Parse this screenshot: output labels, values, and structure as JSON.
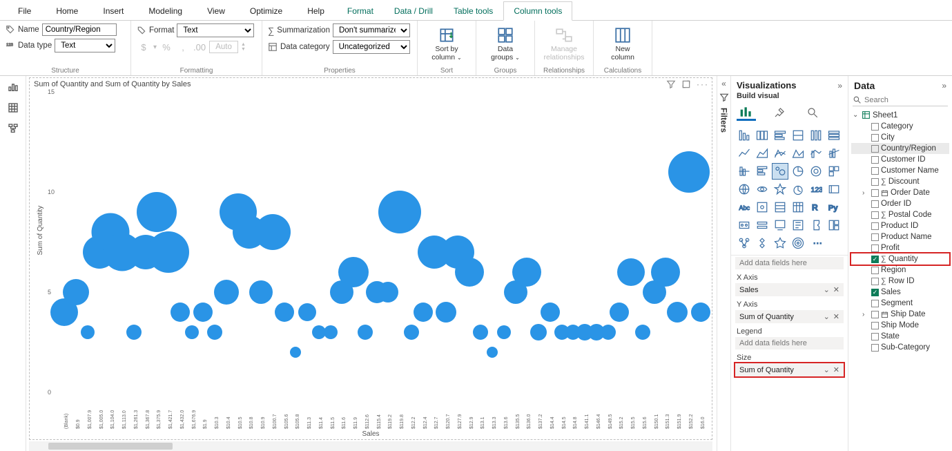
{
  "menu": {
    "file": "File",
    "home": "Home",
    "insert": "Insert",
    "modeling": "Modeling",
    "view": "View",
    "optimize": "Optimize",
    "help": "Help",
    "format": "Format",
    "datadrill": "Data / Drill",
    "tabletools": "Table tools",
    "columntools": "Column tools"
  },
  "ribbon": {
    "structure": {
      "name_lbl": "Name",
      "name_val": "Country/Region",
      "dtype_lbl": "Data type",
      "dtype_val": "Text",
      "group": "Structure"
    },
    "formatting": {
      "fmt_lbl": "Format",
      "fmt_val": "Text",
      "dollar": "$",
      "pct": "%",
      "comma": ",",
      "dec": ".00",
      "auto": "Auto",
      "group": "Formatting"
    },
    "properties": {
      "sum_lbl": "Summarization",
      "sum_val": "Don't summarize",
      "cat_lbl": "Data category",
      "cat_val": "Uncategorized",
      "group": "Properties"
    },
    "sort": {
      "btn1": "Sort by",
      "btn1b": "column",
      "group": "Sort"
    },
    "groups": {
      "btn1": "Data",
      "btn1b": "groups",
      "group": "Groups"
    },
    "rel": {
      "btn1": "Manage",
      "btn1b": "relationships",
      "group": "Relationships"
    },
    "calc": {
      "btn1": "New",
      "btn1b": "column",
      "group": "Calculations"
    }
  },
  "chart": {
    "title": "Sum of Quantity and Sum of Quantity by Sales",
    "ylabel": "Sum of Quantity",
    "xlabel": "Sales",
    "yticks": [
      0,
      5,
      10,
      15
    ],
    "xticks": [
      "(Blank)",
      "$0.9",
      "$1,007.9",
      "$1,005.0",
      "$1,104.0",
      "$1,113.0",
      "$1,261.3",
      "$1,367.8",
      "$1,375.9",
      "$1,421.7",
      "$1,432.0",
      "$1,676.9",
      "$1.9",
      "$10.3",
      "$10.4",
      "$10.5",
      "$10.8",
      "$10.9",
      "$100.7",
      "$105.6",
      "$105.8",
      "$11.3",
      "$11.4",
      "$11.5",
      "$11.6",
      "$11.9",
      "$112.6",
      "$115.4",
      "$119.2",
      "$119.8",
      "$12.2",
      "$12.4",
      "$12.7",
      "$120.7",
      "$127.9",
      "$12.9",
      "$13.1",
      "$13.3",
      "$13.6",
      "$135.5",
      "$136.0",
      "$137.2",
      "$14.4",
      "$14.5",
      "$14.8",
      "$141.1",
      "$146.4",
      "$149.5",
      "$15.2",
      "$15.5",
      "$15.6",
      "$150.1",
      "$151.3",
      "$151.9",
      "$152.2",
      "$16.0"
    ]
  },
  "chart_data": {
    "type": "scatter",
    "xlabel": "Sales",
    "ylabel": "Sum of Quantity",
    "size_field": "Sum of Quantity",
    "ylim": [
      0,
      15
    ],
    "series": [
      {
        "name": "Sum of Quantity",
        "points": [
          {
            "xi": 0,
            "y": 4,
            "s": 40
          },
          {
            "xi": 1,
            "y": 5,
            "s": 38
          },
          {
            "xi": 2,
            "y": 3,
            "s": 20
          },
          {
            "xi": 3,
            "y": 7,
            "s": 48
          },
          {
            "xi": 4,
            "y": 8,
            "s": 55
          },
          {
            "xi": 5,
            "y": 7,
            "s": 55
          },
          {
            "xi": 6,
            "y": 3,
            "s": 22
          },
          {
            "xi": 7,
            "y": 7,
            "s": 50
          },
          {
            "xi": 8,
            "y": 9,
            "s": 58
          },
          {
            "xi": 9,
            "y": 7,
            "s": 60
          },
          {
            "xi": 10,
            "y": 4,
            "s": 28
          },
          {
            "xi": 11,
            "y": 3,
            "s": 20
          },
          {
            "xi": 12,
            "y": 4,
            "s": 28
          },
          {
            "xi": 13,
            "y": 3,
            "s": 22
          },
          {
            "xi": 14,
            "y": 5,
            "s": 36
          },
          {
            "xi": 15,
            "y": 9,
            "s": 54
          },
          {
            "xi": 16,
            "y": 8,
            "s": 48
          },
          {
            "xi": 17,
            "y": 5,
            "s": 34
          },
          {
            "xi": 18,
            "y": 8,
            "s": 52
          },
          {
            "xi": 19,
            "y": 4,
            "s": 28
          },
          {
            "xi": 20,
            "y": 2,
            "s": 16
          },
          {
            "xi": 21,
            "y": 4,
            "s": 26
          },
          {
            "xi": 22,
            "y": 3,
            "s": 20
          },
          {
            "xi": 23,
            "y": 3,
            "s": 20
          },
          {
            "xi": 24,
            "y": 5,
            "s": 34
          },
          {
            "xi": 25,
            "y": 6,
            "s": 44
          },
          {
            "xi": 26,
            "y": 3,
            "s": 22
          },
          {
            "xi": 27,
            "y": 5,
            "s": 32
          },
          {
            "xi": 28,
            "y": 5,
            "s": 30
          },
          {
            "xi": 29,
            "y": 9,
            "s": 62
          },
          {
            "xi": 30,
            "y": 3,
            "s": 22
          },
          {
            "xi": 31,
            "y": 4,
            "s": 28
          },
          {
            "xi": 32,
            "y": 7,
            "s": 48
          },
          {
            "xi": 33,
            "y": 4,
            "s": 30
          },
          {
            "xi": 34,
            "y": 7,
            "s": 48
          },
          {
            "xi": 35,
            "y": 6,
            "s": 42
          },
          {
            "xi": 36,
            "y": 3,
            "s": 22
          },
          {
            "xi": 37,
            "y": 2,
            "s": 16
          },
          {
            "xi": 38,
            "y": 3,
            "s": 20
          },
          {
            "xi": 39,
            "y": 5,
            "s": 34
          },
          {
            "xi": 40,
            "y": 6,
            "s": 42
          },
          {
            "xi": 41,
            "y": 3,
            "s": 24
          },
          {
            "xi": 42,
            "y": 4,
            "s": 28
          },
          {
            "xi": 43,
            "y": 3,
            "s": 22
          },
          {
            "xi": 44,
            "y": 3,
            "s": 22
          },
          {
            "xi": 45,
            "y": 3,
            "s": 24
          },
          {
            "xi": 46,
            "y": 3,
            "s": 24
          },
          {
            "xi": 47,
            "y": 3,
            "s": 22
          },
          {
            "xi": 48,
            "y": 4,
            "s": 28
          },
          {
            "xi": 49,
            "y": 6,
            "s": 40
          },
          {
            "xi": 50,
            "y": 3,
            "s": 22
          },
          {
            "xi": 51,
            "y": 5,
            "s": 34
          },
          {
            "xi": 52,
            "y": 6,
            "s": 42
          },
          {
            "xi": 53,
            "y": 4,
            "s": 30
          },
          {
            "xi": 54,
            "y": 11,
            "s": 60
          },
          {
            "xi": 55,
            "y": 4,
            "s": 28
          }
        ]
      }
    ]
  },
  "filters": {
    "label": "Filters"
  },
  "viz": {
    "title": "Visualizations",
    "sub": "Build visual",
    "x_axis": "X Axis",
    "y_axis": "Y Axis",
    "legend": "Legend",
    "size": "Size",
    "add": "Add data fields here",
    "x_field": "Sales",
    "y_field": "Sum of Quantity",
    "size_field": "Sum of Quantity"
  },
  "data": {
    "title": "Data",
    "search_ph": "Search",
    "table": "Sheet1",
    "fields": [
      {
        "n": "Category"
      },
      {
        "n": "City"
      },
      {
        "n": "Country/Region",
        "sel": true
      },
      {
        "n": "Customer ID"
      },
      {
        "n": "Customer Name"
      },
      {
        "n": "Discount",
        "sigma": true
      },
      {
        "n": "Order Date",
        "cal": true,
        "exp": true
      },
      {
        "n": "Order ID"
      },
      {
        "n": "Postal Code",
        "sigma": true
      },
      {
        "n": "Product ID"
      },
      {
        "n": "Product Name"
      },
      {
        "n": "Profit"
      },
      {
        "n": "Quantity",
        "sigma": true,
        "chk": true,
        "red": true
      },
      {
        "n": "Region"
      },
      {
        "n": "Row ID",
        "sigma": true
      },
      {
        "n": "Sales",
        "chk": true
      },
      {
        "n": "Segment"
      },
      {
        "n": "Ship Date",
        "cal": true,
        "exp": true
      },
      {
        "n": "Ship Mode"
      },
      {
        "n": "State"
      },
      {
        "n": "Sub-Category"
      }
    ]
  }
}
